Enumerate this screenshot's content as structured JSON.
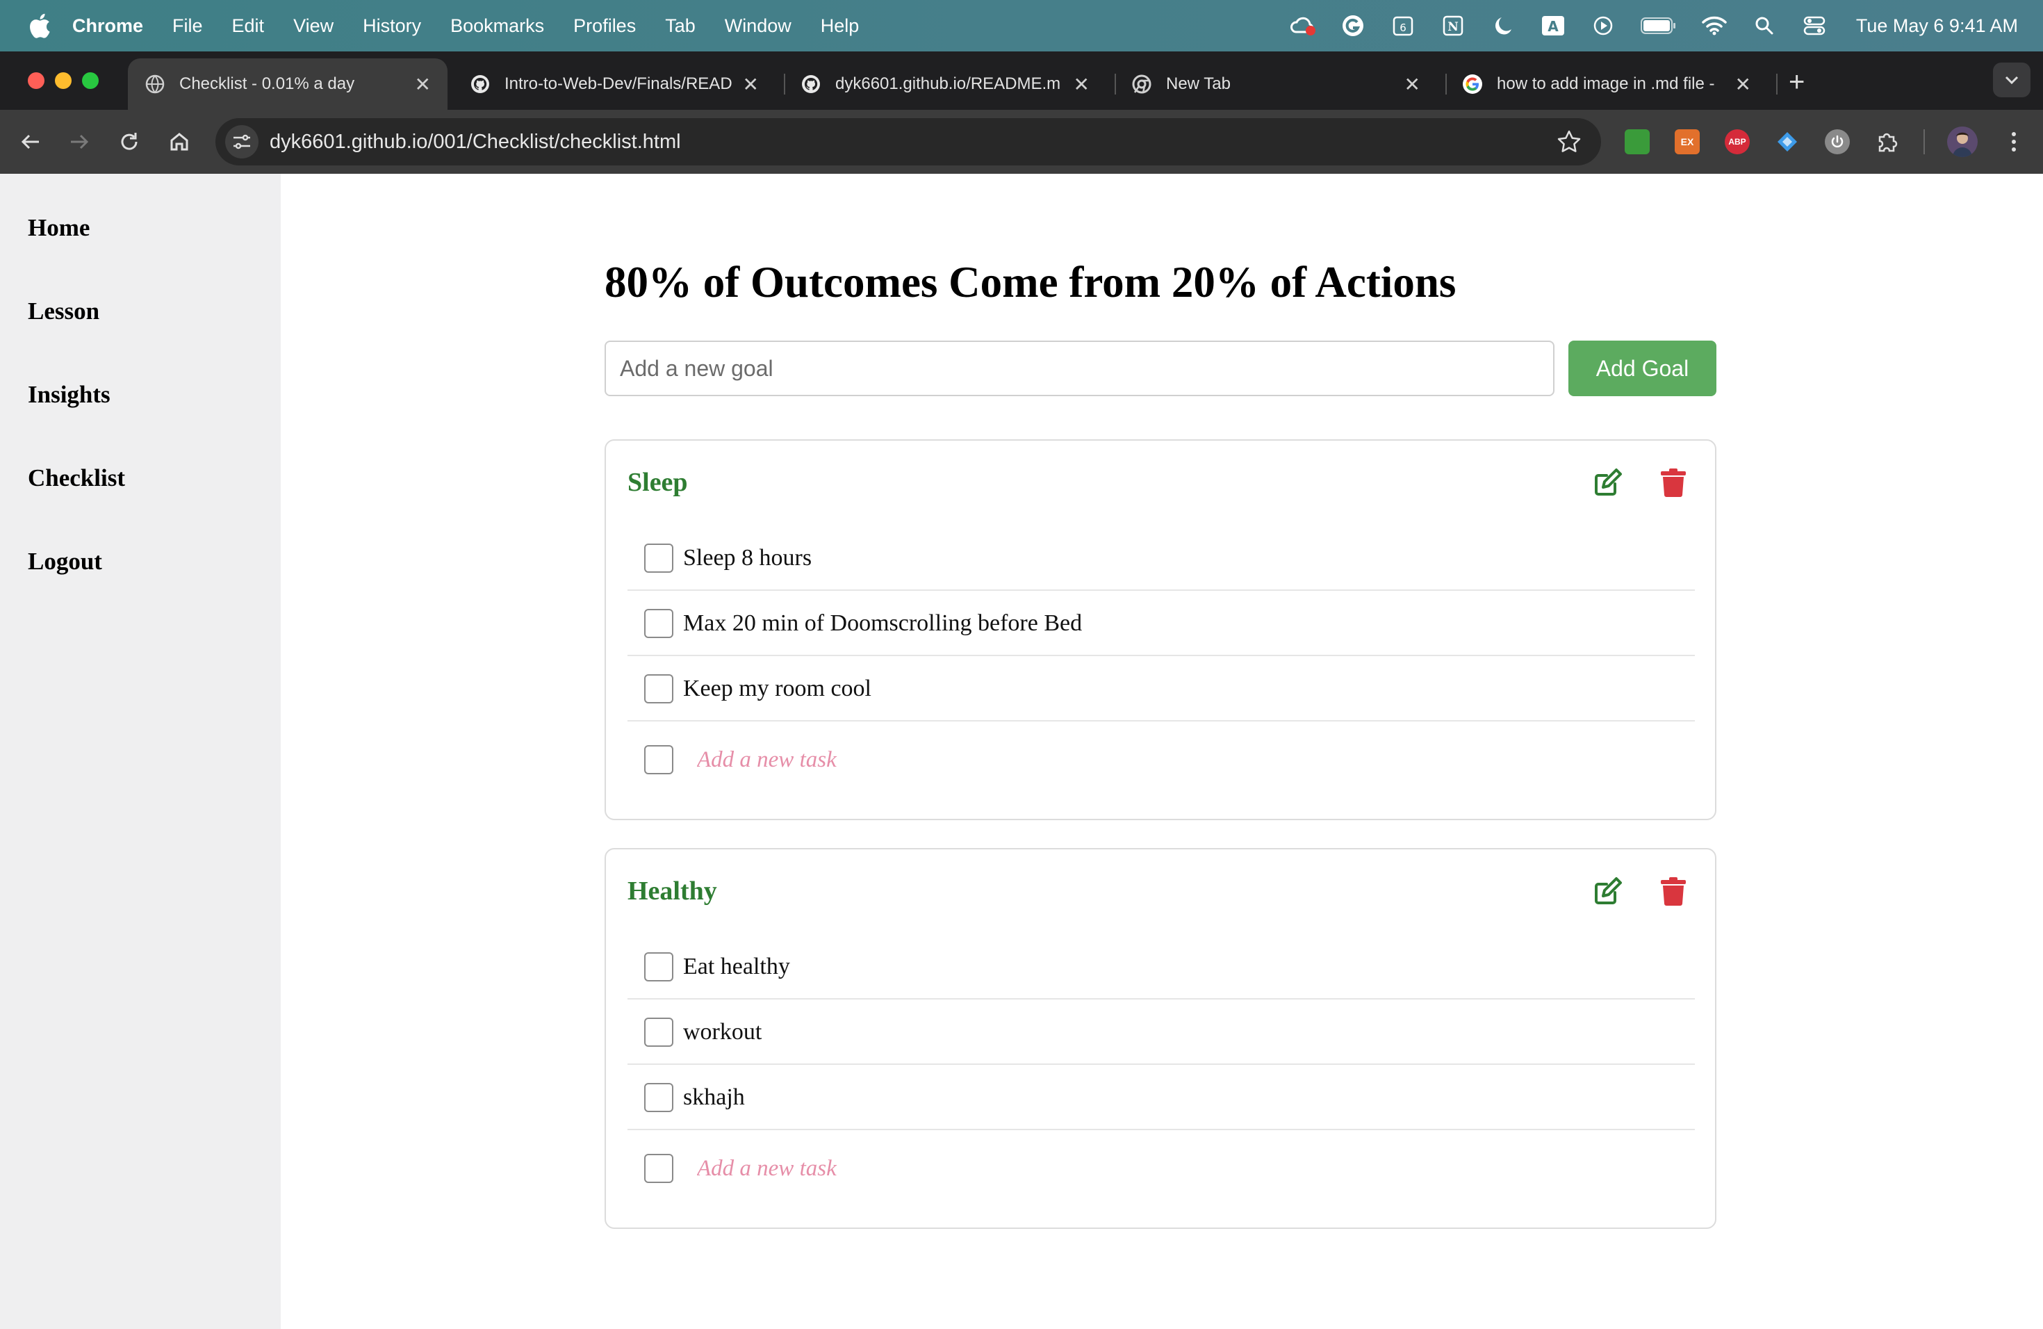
{
  "menubar": {
    "app_name": "Chrome",
    "items": [
      "File",
      "Edit",
      "View",
      "History",
      "Bookmarks",
      "Profiles",
      "Tab",
      "Window",
      "Help"
    ],
    "clock": "Tue May 6  9:41 AM"
  },
  "browser": {
    "tabs": [
      {
        "title": "Checklist - 0.01% a day",
        "icon": "globe-icon",
        "active": true
      },
      {
        "title": "Intro-to-Web-Dev/Finals/READ",
        "icon": "github-icon",
        "active": false
      },
      {
        "title": "dyk6601.github.io/README.m",
        "icon": "github-icon",
        "active": false
      },
      {
        "title": "New Tab",
        "icon": "chrome-icon",
        "active": false
      },
      {
        "title": "how to add image in .md file -",
        "icon": "google-icon",
        "active": false
      }
    ],
    "url": "dyk6601.github.io/001/Checklist/checklist.html",
    "extensions": [
      {
        "name": "ext-green-icon",
        "label": "",
        "color": "#3a9b3a"
      },
      {
        "name": "ext-ex-icon",
        "label": "EX",
        "color": "#e2702c"
      },
      {
        "name": "adblock-icon",
        "label": "ABP",
        "color": "#d52b3a"
      },
      {
        "name": "ext-diamond-icon",
        "label": "",
        "color": "#3d9be9"
      },
      {
        "name": "ext-power-icon",
        "label": "",
        "color": "#8a8a8a"
      }
    ]
  },
  "sidebar": {
    "links": [
      "Home",
      "Lesson",
      "Insights",
      "Checklist",
      "Logout"
    ]
  },
  "main": {
    "heading": "80% of Outcomes Come from 20% of Actions",
    "goal_input_placeholder": "Add a new goal",
    "add_goal_label": "Add Goal",
    "task_placeholder": "Add a new task"
  },
  "goals": [
    {
      "title": "Sleep",
      "tasks": [
        "Sleep 8 hours",
        "Max 20 min of Doomscrolling before Bed",
        "Keep my room cool"
      ]
    },
    {
      "title": "Healthy",
      "tasks": [
        "Eat healthy",
        "workout",
        "skhajh"
      ]
    }
  ],
  "colors": {
    "accent_green": "#5cab5f",
    "goal_title_green": "#2e7d32",
    "delete_red": "#d9363e",
    "placeholder_pink": "#e68ea8"
  }
}
